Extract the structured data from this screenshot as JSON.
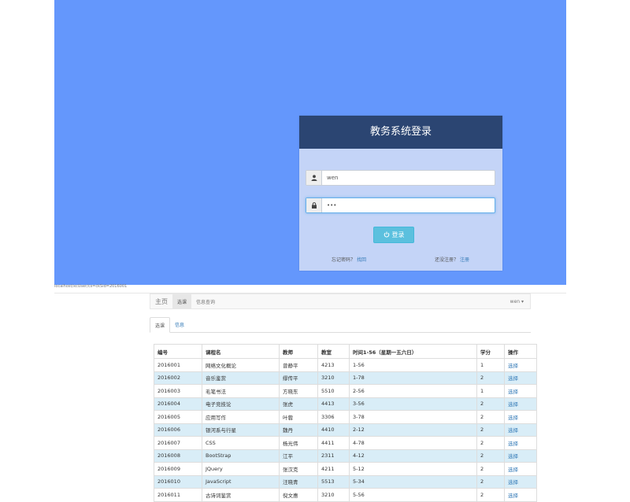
{
  "login": {
    "title": "教务系统登录",
    "username_value": "wen",
    "password_value": "•••",
    "login_button": "登录",
    "forgot_label": "忘记密码？",
    "forgot_link": "找回",
    "register_label": "还没注册？",
    "register_link": "注册"
  },
  "url_bar": {
    "url": "localhost/xcUser/cs=ckSid=2016001"
  },
  "navbar": {
    "brand": "主页",
    "items": [
      "选课",
      "信息查询"
    ],
    "user": "wen ▾"
  },
  "tabs": [
    "选课",
    "信息"
  ],
  "table": {
    "headers": [
      "编号",
      "课程名",
      "教师",
      "教室",
      "时间1-56（星期一五六日）",
      "学分",
      "操作"
    ],
    "rows": [
      [
        "2016001",
        "网络文化概论",
        "曾静平",
        "4213",
        "1-56",
        "1",
        "选择"
      ],
      [
        "2016002",
        "音乐鉴赏",
        "缪传平",
        "3210",
        "1-78",
        "2",
        "选择"
      ],
      [
        "2016003",
        "毛笔书法",
        "方晓东",
        "5510",
        "2-56",
        "1",
        "选择"
      ],
      [
        "2016004",
        "电子竞技论",
        "张虎",
        "4413",
        "3-56",
        "2",
        "选择"
      ],
      [
        "2016005",
        "应用写作",
        "叶蓉",
        "3306",
        "3-78",
        "2",
        "选择"
      ],
      [
        "2016006",
        "银河系与行星",
        "魏丹",
        "4410",
        "2-12",
        "2",
        "选择"
      ],
      [
        "2016007",
        "CSS",
        "杨光伟",
        "4411",
        "4-78",
        "2",
        "选择"
      ],
      [
        "2016008",
        "BootStrap",
        "江平",
        "2311",
        "4-12",
        "2",
        "选择"
      ],
      [
        "2016009",
        "JQuery",
        "张汉克",
        "4211",
        "5-12",
        "2",
        "选择"
      ],
      [
        "2016010",
        "JavaScript",
        "汪晓青",
        "5513",
        "5-34",
        "2",
        "选择"
      ],
      [
        "2016011",
        "古诗词鉴赏",
        "倪文惠",
        "3210",
        "5-56",
        "2",
        "选择"
      ]
    ]
  },
  "colors": {
    "login_bg": "#6497fc",
    "panel_bg": "#c4d4f7",
    "header_bg": "#2b4572",
    "button_bg": "#5bc0de",
    "row_highlight": "#d9edf7",
    "link": "#337ab7"
  }
}
